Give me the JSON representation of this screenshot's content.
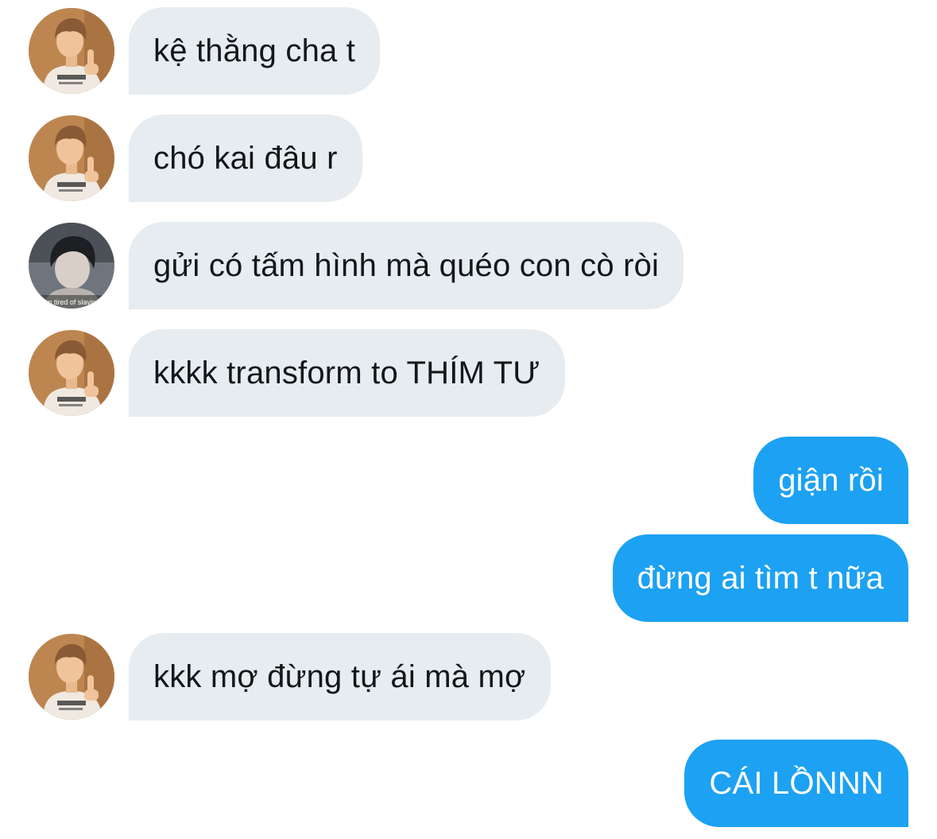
{
  "conversation": {
    "messages": [
      {
        "direction": "incoming",
        "avatar": "avatar-person-a",
        "text": "kệ thằng cha t"
      },
      {
        "direction": "incoming",
        "avatar": "avatar-person-a",
        "text": "chó kai đâu r"
      },
      {
        "direction": "incoming",
        "avatar": "avatar-person-b",
        "text": "gửi có tấm hình mà quéo con cò ròi"
      },
      {
        "direction": "incoming",
        "avatar": "avatar-person-a",
        "text": "kkkk transform to THÍM TƯ"
      },
      {
        "direction": "outgoing",
        "text": "giận rồi"
      },
      {
        "direction": "outgoing",
        "text": "đừng ai tìm t nữa"
      },
      {
        "direction": "incoming",
        "avatar": "avatar-person-a",
        "text": "kkk mợ đừng tự ái mà mợ"
      },
      {
        "direction": "outgoing",
        "text": "CÁI LỒNNN"
      }
    ]
  },
  "avatars": {
    "person-b": {
      "caption": "i'm tired of slaying"
    }
  },
  "colors": {
    "incoming_bubble": "#e6ecf0",
    "outgoing_bubble": "#1da1f2",
    "incoming_text": "#14171a",
    "outgoing_text": "#ffffff"
  }
}
